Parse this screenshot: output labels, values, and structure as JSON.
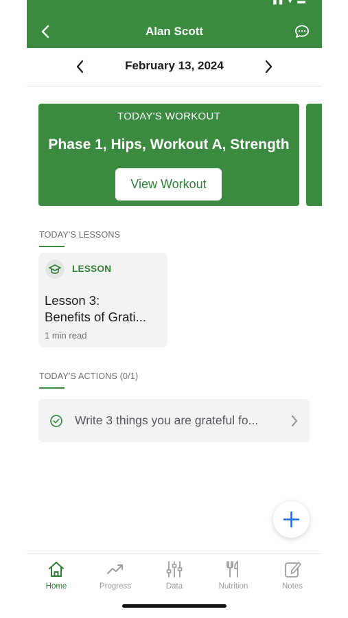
{
  "header": {
    "title": "Alan Scott",
    "back_icon": "chevron-left-icon",
    "chat_icon": "chat-bubble-icon"
  },
  "date_nav": {
    "date": "February 13, 2024"
  },
  "workout": {
    "kicker": "TODAY'S WORKOUT",
    "title": "Phase 1, Hips, Workout A, Strength",
    "button_label": "View Workout"
  },
  "lessons": {
    "section_label": "TODAY'S LESSONS",
    "items": [
      {
        "badge": "LESSON",
        "title_line1": "Lesson 3:",
        "title_line2": "Benefits of Grati...",
        "meta": "1 min read"
      }
    ]
  },
  "actions": {
    "section_label": "TODAY'S ACTIONS (0/1)",
    "items": [
      {
        "text": "Write 3 things you are grateful fo..."
      }
    ]
  },
  "tabs": [
    {
      "label": "Home",
      "icon": "home-icon",
      "active": true
    },
    {
      "label": "Progress",
      "icon": "trend-up-icon"
    },
    {
      "label": "Data",
      "icon": "sliders-icon"
    },
    {
      "label": "Nutrition",
      "icon": "fork-knife-icon"
    },
    {
      "label": "Notes",
      "icon": "notes-icon"
    }
  ],
  "colors": {
    "brand_green": "#3a8a3f",
    "fab_plus": "#1a6fe0"
  }
}
